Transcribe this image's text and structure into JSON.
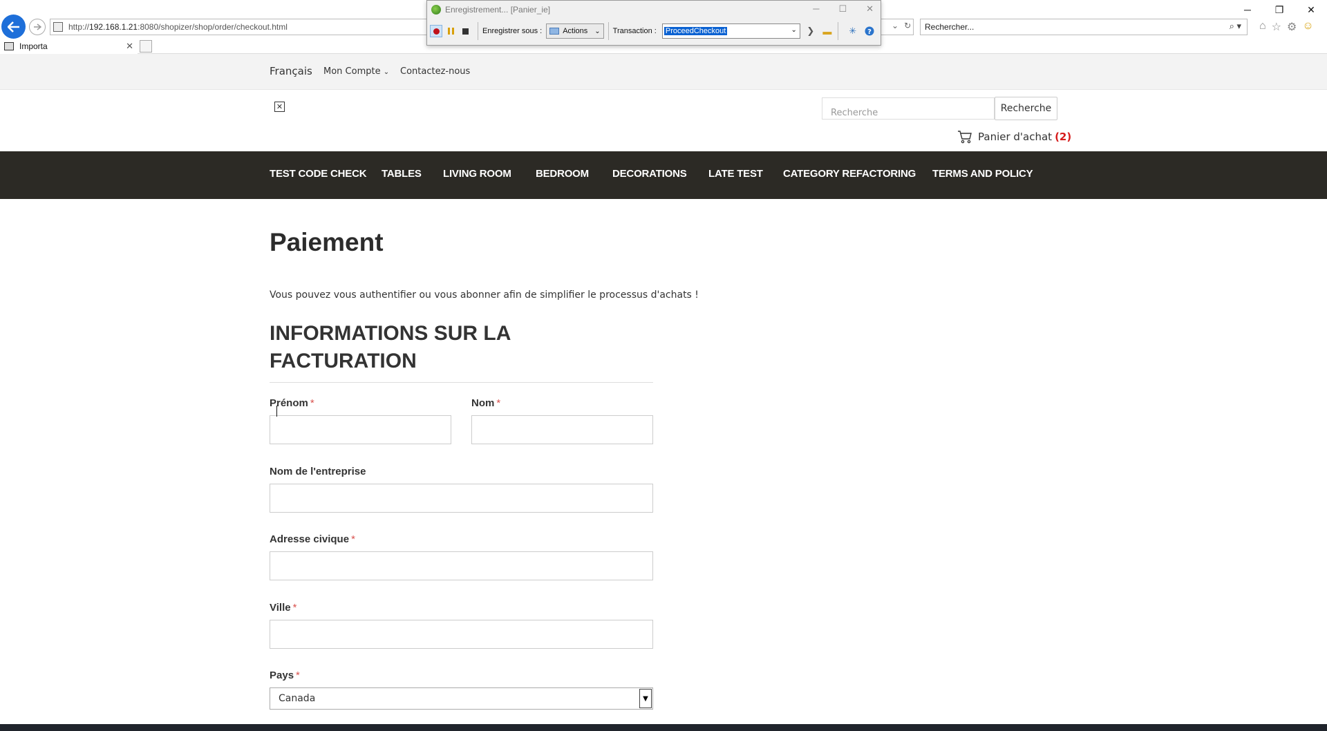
{
  "browser": {
    "url_prefix": "http://",
    "url_host": "192.168.1.21",
    "url_rest": ":8080/shopizer/shop/order/checkout.html",
    "search_placeholder": "Rechercher...",
    "tab_title": "Importa",
    "window_controls": [
      "─",
      "❐",
      "✕"
    ]
  },
  "recorder": {
    "title": "Enregistrement... [Panier_ie]",
    "save_as_label": "Enregistrer sous :",
    "actions_label": "Actions",
    "transaction_label": "Transaction :",
    "transaction_value": "ProceedCheckout"
  },
  "site": {
    "top_links": {
      "language": "Français",
      "account": "Mon Compte",
      "contact": "Contactez-nous"
    },
    "search_placeholder": "Recherche",
    "search_button": "Recherche",
    "cart_label": "Panier d'achat",
    "cart_count": "(2)",
    "categories": [
      "TEST CODE CHECK",
      "TABLES",
      "LIVING ROOM",
      "BEDROOM",
      "DECORATIONS",
      "LATE TEST",
      "CATEGORY REFACTORING",
      "TERMS AND POLICY"
    ]
  },
  "checkout": {
    "title": "Paiement",
    "intro": "Vous pouvez vous authentifier ou vous abonner afin de simplifier le processus d'achats !",
    "section_title": "INFORMATIONS SUR LA FACTURATION",
    "required_mark": "*",
    "fields": {
      "first_name": "Prénom",
      "last_name": "Nom",
      "company": "Nom de l'entreprise",
      "address": "Adresse civique",
      "city": "Ville",
      "country": "Pays",
      "country_value": "Canada"
    }
  },
  "colors": {
    "nav_bg": "#2c2a25",
    "cart_count": "#d61b1b",
    "required": "#d9534f",
    "back_button": "#1e6fd9"
  }
}
